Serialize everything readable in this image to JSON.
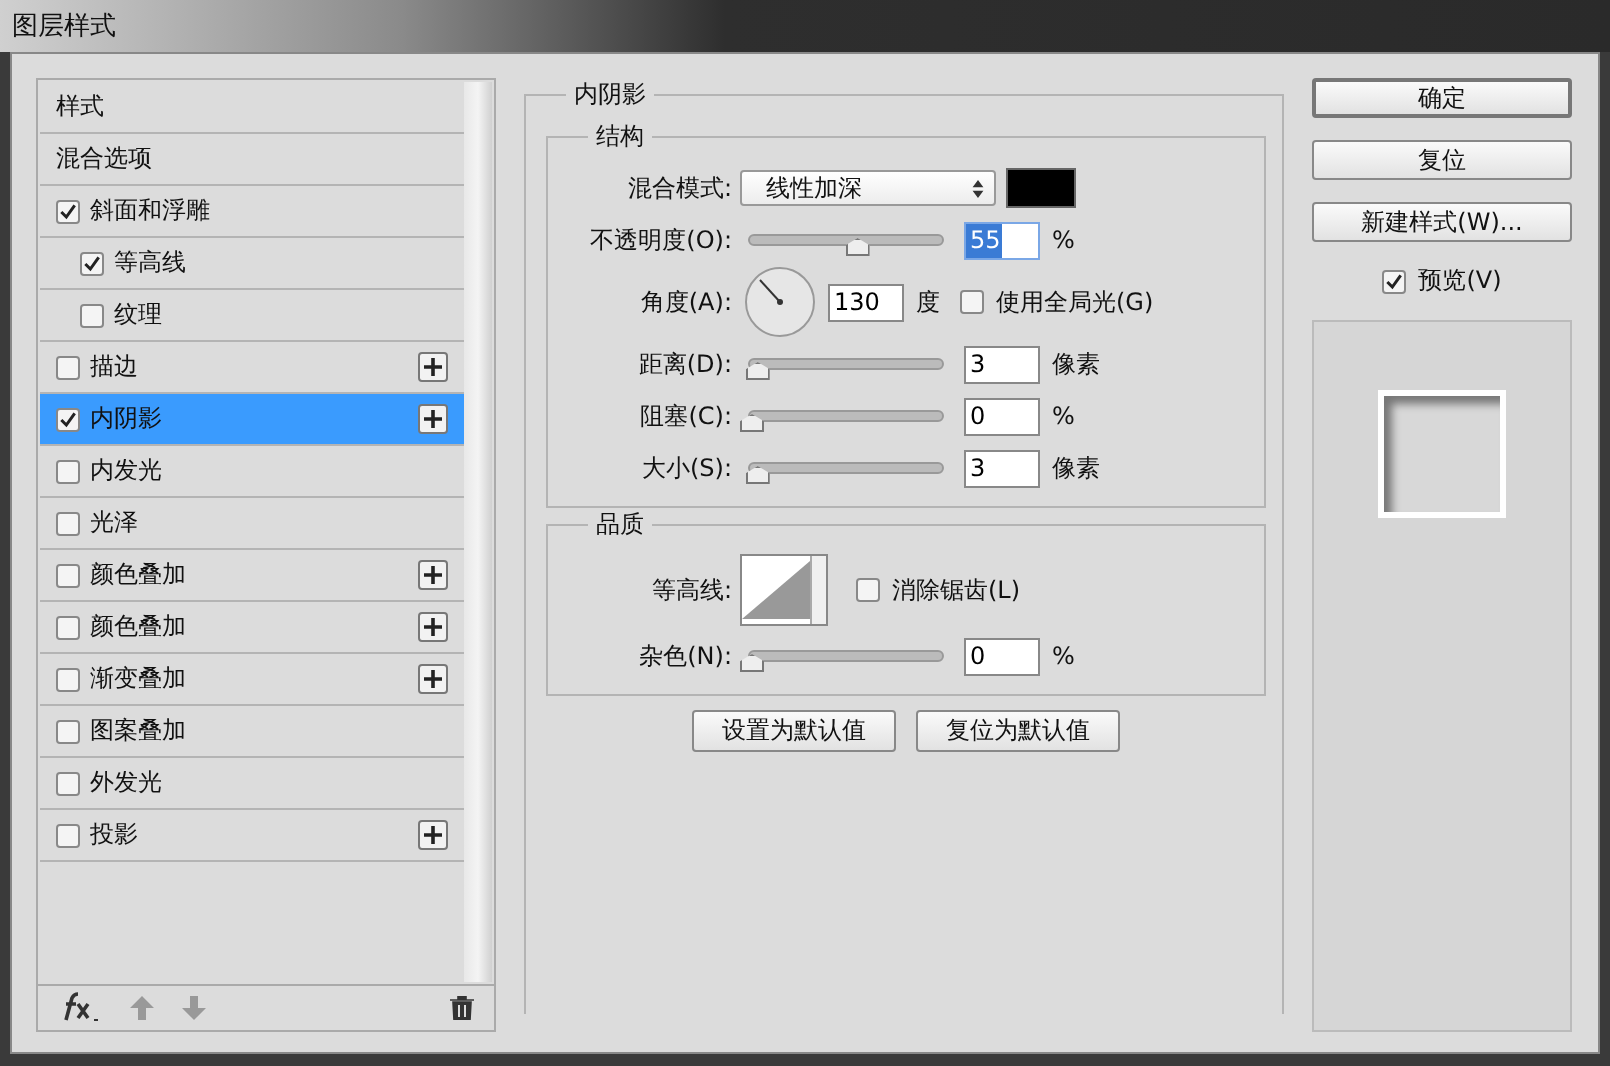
{
  "window": {
    "title": "图层样式"
  },
  "sidebar": {
    "items": [
      {
        "kind": "header",
        "label": "样式",
        "selected": false
      },
      {
        "kind": "header",
        "label": "混合选项",
        "selected": false
      },
      {
        "kind": "effect",
        "label": "斜面和浮雕",
        "checked": true,
        "selected": false,
        "add_button": false,
        "children": [
          {
            "kind": "effect",
            "label": "等高线",
            "checked": true,
            "selected": false,
            "add_button": false
          },
          {
            "kind": "effect",
            "label": "纹理",
            "checked": false,
            "selected": false,
            "add_button": false
          }
        ]
      },
      {
        "kind": "effect",
        "label": "描边",
        "checked": false,
        "selected": false,
        "add_button": true
      },
      {
        "kind": "effect",
        "label": "内阴影",
        "checked": true,
        "selected": true,
        "add_button": true
      },
      {
        "kind": "effect",
        "label": "内发光",
        "checked": false,
        "selected": false,
        "add_button": false
      },
      {
        "kind": "effect",
        "label": "光泽",
        "checked": false,
        "selected": false,
        "add_button": false
      },
      {
        "kind": "effect",
        "label": "颜色叠加",
        "checked": false,
        "selected": false,
        "add_button": true
      },
      {
        "kind": "effect",
        "label": "颜色叠加",
        "checked": false,
        "selected": false,
        "add_button": true
      },
      {
        "kind": "effect",
        "label": "渐变叠加",
        "checked": false,
        "selected": false,
        "add_button": true
      },
      {
        "kind": "effect",
        "label": "图案叠加",
        "checked": false,
        "selected": false,
        "add_button": false
      },
      {
        "kind": "effect",
        "label": "外发光",
        "checked": false,
        "selected": false,
        "add_button": false
      },
      {
        "kind": "effect",
        "label": "投影",
        "checked": false,
        "selected": false,
        "add_button": true
      }
    ]
  },
  "panel": {
    "title": "内阴影",
    "structure": {
      "title": "结构",
      "rows": [
        {
          "kind": "select",
          "label": "混合模式:",
          "value": "线性加深"
        },
        {
          "kind": "slider",
          "label": "不透明度(O):",
          "level": 0.55,
          "value": "55",
          "unit": "%",
          "value_selected": true
        },
        {
          "kind": "angle",
          "label": "角度(A):",
          "value": "130",
          "unit": "度",
          "option": {
            "label": "使用全局光(G)",
            "checked": false
          }
        },
        {
          "kind": "slider",
          "label": "距离(D):",
          "level": 0.03,
          "value": "3",
          "unit": "像素",
          "value_selected": false
        },
        {
          "kind": "slider",
          "label": "阻塞(C):",
          "level": 0,
          "value": "0",
          "unit": "%",
          "value_selected": false
        },
        {
          "kind": "slider",
          "label": "大小(S):",
          "level": 0.03,
          "value": "3",
          "unit": "像素",
          "value_selected": false
        }
      ]
    },
    "quality": {
      "title": "品质",
      "rows": [
        {
          "kind": "contour",
          "label": "等高线:",
          "option": {
            "label": "消除锯齿(L)",
            "checked": false
          }
        },
        {
          "kind": "slider",
          "label": "杂色(N):",
          "level": 0,
          "value": "0",
          "unit": "%",
          "value_selected": false
        }
      ]
    },
    "buttons": [
      "设置为默认值",
      "复位为默认值"
    ]
  },
  "actions": {
    "buttons": [
      {
        "label": "确定",
        "default": true
      },
      {
        "label": "复位",
        "default": false
      },
      {
        "label": "新建样式(W)...",
        "default": false
      }
    ],
    "preview": {
      "label": "预览(V)",
      "checked": true
    }
  }
}
